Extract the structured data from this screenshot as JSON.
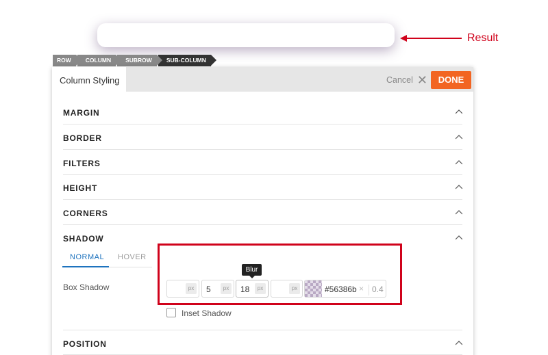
{
  "annotation": {
    "result_label": "Result",
    "accent_color": "#d0021b"
  },
  "breadcrumb": [
    "ROW",
    "COLUMN",
    "SUBROW",
    "SUB-COLUMN"
  ],
  "panel": {
    "tab_label": "Column Styling",
    "cancel_label": "Cancel",
    "done_label": "DONE",
    "done_color": "#f26522"
  },
  "sections": [
    "MARGIN",
    "BORDER",
    "FILTERS",
    "HEIGHT",
    "CORNERS",
    "SHADOW",
    "POSITION"
  ],
  "shadow": {
    "tabs": [
      "NORMAL",
      "HOVER"
    ],
    "active_tab": "NORMAL",
    "box_shadow_label": "Box Shadow",
    "inputs": [
      {
        "name": "horizontal",
        "value": "",
        "unit": "px"
      },
      {
        "name": "vertical",
        "value": "5",
        "unit": "px"
      },
      {
        "name": "blur",
        "value": "18",
        "unit": "px"
      },
      {
        "name": "spread",
        "value": "",
        "unit": "px"
      }
    ],
    "tooltip": "Blur",
    "color_hex": "#56386b",
    "color_clear": "×",
    "alpha": "0.4",
    "inset_label": "Inset Shadow"
  }
}
